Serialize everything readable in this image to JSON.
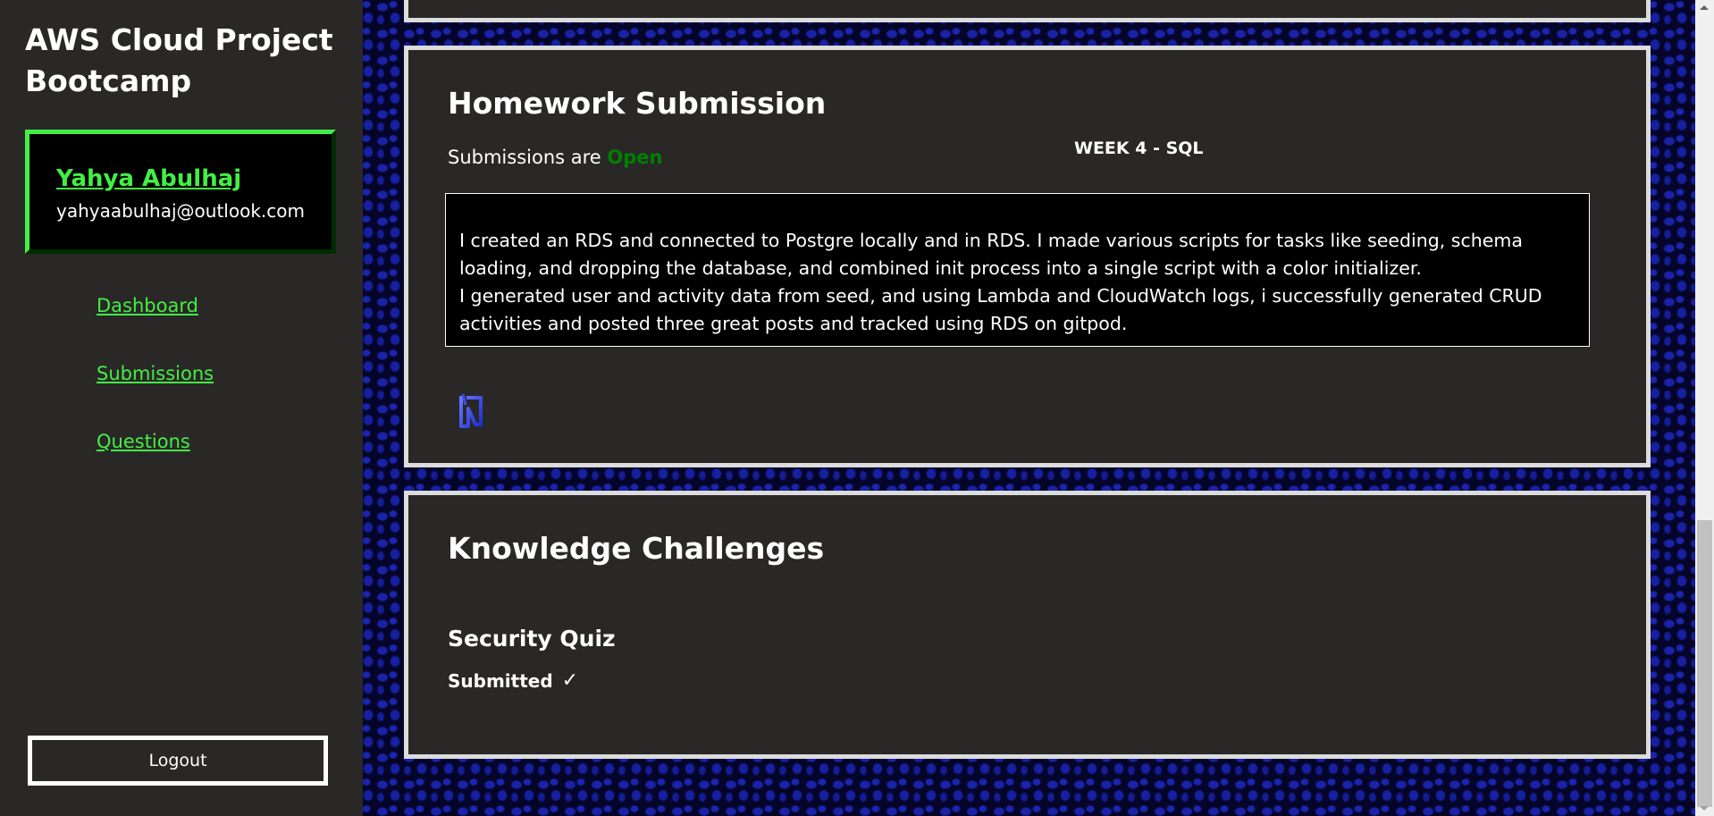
{
  "sidebar": {
    "app_title": "AWS Cloud Project Bootcamp",
    "profile": {
      "name": "Yahya Abulhaj",
      "email": "yahyaabulhaj@outlook.com"
    },
    "nav": [
      {
        "label": "Dashboard"
      },
      {
        "label": "Submissions"
      },
      {
        "label": "Questions"
      }
    ],
    "logout_label": "Logout"
  },
  "homework": {
    "title": "Homework Submission",
    "status_prefix": "Submissions are",
    "status_value": "Open",
    "week_label": "WEEK 4 - SQL",
    "submission_text": "I created an RDS and connected to Postgre locally and in RDS. I made various scripts for tasks like seeding, schema loading, and dropping the database, and combined init process into a single script with a color initializer.\nI generated user and activity data from seed, and using Lambda and CloudWatch logs, i successfully generated CRUD activities and posted three great posts and tracked using RDS on gitpod.",
    "edit_icon": "edit-icon"
  },
  "knowledge": {
    "title": "Knowledge Challenges",
    "quizzes": [
      {
        "title": "Security Quiz",
        "status": "Submitted",
        "status_icon": "✓"
      }
    ]
  },
  "colors": {
    "accent_green": "#44ee44",
    "open_green": "#008000",
    "panel_bg": "#292827",
    "panel_border": "#dcdcdc"
  }
}
